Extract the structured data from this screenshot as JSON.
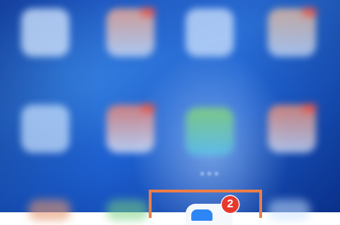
{
  "home_screen": {
    "apps": [
      {
        "icon": "blurred-app-icon"
      },
      {
        "icon": "blurred-app-icon"
      },
      {
        "icon": "blurred-app-icon"
      },
      {
        "icon": "blurred-app-icon"
      },
      {
        "icon": "blurred-app-icon"
      },
      {
        "icon": "blurred-app-icon"
      },
      {
        "icon": "blurred-app-icon"
      },
      {
        "icon": "blurred-app-icon"
      }
    ],
    "highlight_color": "#ee7c47"
  },
  "dock": {
    "focused_app": {
      "icon": "messages-app-icon",
      "badge_count": "2",
      "badge_color": "#e8392f"
    }
  }
}
